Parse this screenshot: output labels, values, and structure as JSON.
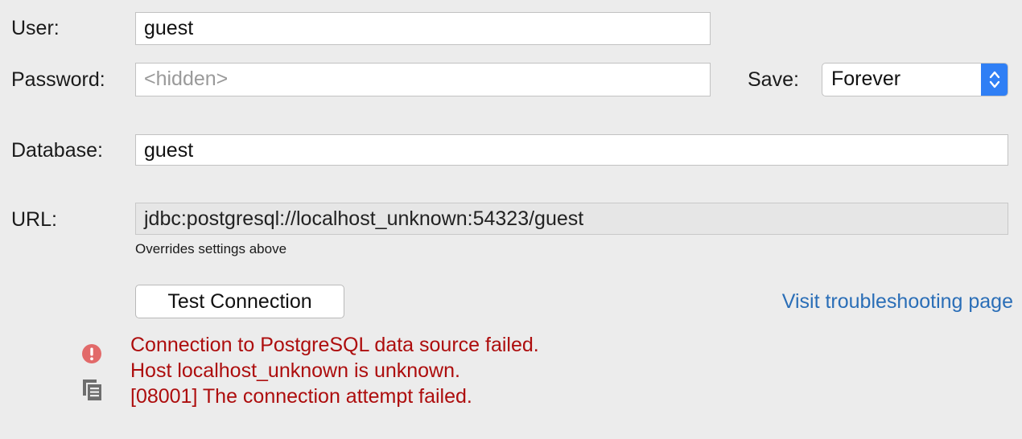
{
  "form": {
    "user": {
      "label": "User:",
      "value": "guest"
    },
    "password": {
      "label": "Password:",
      "placeholder": "<hidden>"
    },
    "save": {
      "label": "Save:",
      "selected": "Forever"
    },
    "database": {
      "label": "Database:",
      "value": "guest"
    },
    "url": {
      "label": "URL:",
      "value": "jdbc:postgresql://localhost_unknown:54323/guest",
      "hint": "Overrides settings above"
    }
  },
  "actions": {
    "test_connection": "Test Connection",
    "troubleshooting_link": "Visit troubleshooting page"
  },
  "error": {
    "lines": [
      "Connection to PostgreSQL data source failed.",
      "Host localhost_unknown is unknown.",
      "[08001] The connection attempt failed."
    ],
    "icons": {
      "status": "error-icon",
      "copy": "copy-icon"
    },
    "color": "#ad0d0d"
  },
  "colors": {
    "background": "#ececec",
    "link": "#2a6eb7",
    "select_accent": "#2f7ff5"
  }
}
